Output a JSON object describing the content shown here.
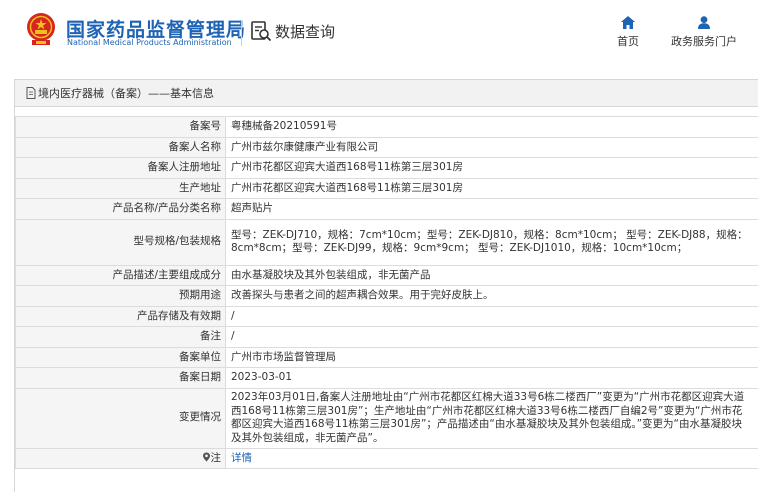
{
  "header": {
    "site_title": "国家药品监督管理局",
    "site_subtitle": "National Medical Products Administration",
    "query_label": "数据查询",
    "nav": [
      {
        "label": "首页",
        "icon": "home-icon"
      },
      {
        "label": "政务服务门户",
        "icon": "user-icon"
      }
    ]
  },
  "colors": {
    "brand": "#1e63b4",
    "emblem_red": "#d7261d",
    "emblem_gold": "#f2c01e"
  },
  "breadcrumb": "境内医疗器械（备案）——基本信息",
  "rows": [
    {
      "label": "备案号",
      "value": "粤穗械备20210591号"
    },
    {
      "label": "备案人名称",
      "value": "广州市兹尔康健康产业有限公司"
    },
    {
      "label": "备案人注册地址",
      "value": "广州市花都区迎宾大道西168号11栋第三层301房"
    },
    {
      "label": "生产地址",
      "value": "广州市花都区迎宾大道西168号11栋第三层301房"
    },
    {
      "label": "产品名称/产品分类名称",
      "value": "超声贴片"
    },
    {
      "label": "型号规格/包装规格",
      "value": "型号：ZEK-DJ710，规格：7cm*10cm；型号：ZEK-DJ810，规格：8cm*10cm； 型号：ZEK-DJ88，规格：8cm*8cm；型号：ZEK-DJ99，规格：9cm*9cm； 型号：ZEK-DJ1010，规格：10cm*10cm；"
    },
    {
      "label": "产品描述/主要组成成分",
      "value": "由水基凝胶块及其外包装组成，非无菌产品"
    },
    {
      "label": "预期用途",
      "value": "改善探头与患者之间的超声耦合效果。用于完好皮肤上。"
    },
    {
      "label": "产品存储及有效期",
      "value": "/"
    },
    {
      "label": "备注",
      "value": "/"
    },
    {
      "label": "备案单位",
      "value": "广州市市场监督管理局"
    },
    {
      "label": "备案日期",
      "value": "2023-03-01"
    },
    {
      "label": "变更情况",
      "value": "2023年03月01日,备案人注册地址由“广州市花都区红棉大道33号6栋二楼西厂”变更为“广州市花都区迎宾大道西168号11栋第三层301房”；生产地址由“广州市花都区红棉大道33号6栋二楼西厂自编2号”变更为“广州市花都区迎宾大道西168号11栋第三层301房”；产品描述由“由水基凝胶块及其外包装组成。”变更为“由水基凝胶块及其外包装组成，非无菌产品”。"
    }
  ],
  "detail_row": {
    "icon": "location-note-icon",
    "label": "注",
    "link": "详情"
  }
}
